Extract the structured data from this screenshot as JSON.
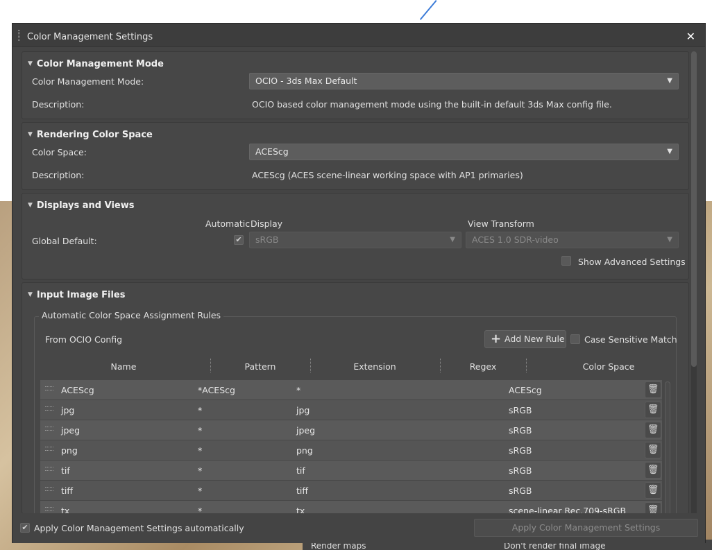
{
  "dialog": {
    "title": "Color Management Settings",
    "close_glyph": "✕"
  },
  "mode_section": {
    "heading": "Color Management Mode",
    "mode_label": "Color Management Mode:",
    "mode_value": "OCIO - 3ds Max Default",
    "description_label": "Description:",
    "description_value": "OCIO based color management mode using the built-in default 3ds Max config file."
  },
  "rendering_section": {
    "heading": "Rendering Color Space",
    "color_space_label": "Color Space:",
    "color_space_value": "ACEScg",
    "description_label": "Description:",
    "description_value": "ACEScg (ACES scene-linear working space with AP1 primaries)"
  },
  "displays_section": {
    "heading": "Displays and Views",
    "automatic_header": "Automatic",
    "display_header": "Display",
    "view_transform_header": "View Transform",
    "global_default_label": "Global Default:",
    "automatic_checked": true,
    "display_value": "sRGB",
    "view_transform_value": "ACES 1.0 SDR-video",
    "show_advanced_label": "Show Advanced Settings",
    "show_advanced_checked": false
  },
  "input_section": {
    "heading": "Input Image Files",
    "group_title": "Automatic Color Space Assignment Rules",
    "from_ocio_label": "From OCIO Config",
    "add_rule_label": "Add New Rule",
    "case_sensitive_label": "Case Sensitive Match",
    "case_sensitive_checked": false,
    "columns": [
      "Name",
      "Pattern",
      "Extension",
      "Regex",
      "Color Space"
    ],
    "rows": [
      {
        "name": "ACEScg",
        "pattern": "*ACEScg",
        "extension": "*",
        "regex": "",
        "color_space": "ACEScg"
      },
      {
        "name": "jpg",
        "pattern": "*",
        "extension": "jpg",
        "regex": "",
        "color_space": "sRGB"
      },
      {
        "name": "jpeg",
        "pattern": "*",
        "extension": "jpeg",
        "regex": "",
        "color_space": "sRGB"
      },
      {
        "name": "png",
        "pattern": "*",
        "extension": "png",
        "regex": "",
        "color_space": "sRGB"
      },
      {
        "name": "tif",
        "pattern": "*",
        "extension": "tif",
        "regex": "",
        "color_space": "sRGB"
      },
      {
        "name": "tiff",
        "pattern": "*",
        "extension": "tiff",
        "regex": "",
        "color_space": "sRGB"
      },
      {
        "name": "tx",
        "pattern": "*",
        "extension": "tx",
        "regex": "",
        "color_space": "scene-linear Rec.709-sRGB"
      }
    ]
  },
  "footer": {
    "apply_auto_label": "Apply Color Management Settings automatically",
    "apply_auto_checked": true,
    "apply_button_label": "Apply Color Management Settings"
  },
  "background": {
    "render_maps_label": "Render maps",
    "dont_render_label": "Don't render final image"
  },
  "icons": {
    "check": "✔",
    "dropdown_arrow": "▼",
    "section_triangle": "▼",
    "plus": "+",
    "trash": "🗑"
  }
}
